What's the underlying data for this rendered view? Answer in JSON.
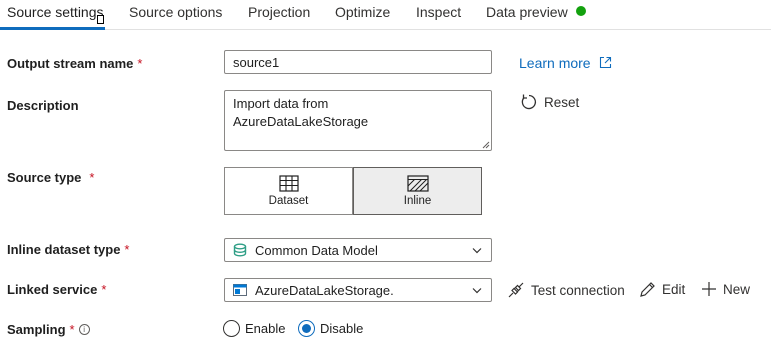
{
  "tabs": [
    {
      "label": "Source settings",
      "active": true
    },
    {
      "label": "Source options"
    },
    {
      "label": "Projection"
    },
    {
      "label": "Optimize"
    },
    {
      "label": "Inspect"
    },
    {
      "label": "Data preview",
      "status": "green-dot"
    }
  ],
  "form": {
    "output_stream_name": {
      "label": "Output stream name",
      "required_mark": "*",
      "value": "source1"
    },
    "description": {
      "label": "Description",
      "value": "Import data from\nAzureDataLakeStorage"
    },
    "source_type": {
      "label": "Source type",
      "required_mark": "*",
      "options": [
        {
          "label": "Dataset",
          "icon": "table-icon",
          "selected": false
        },
        {
          "label": "Inline",
          "icon": "inline-hatched-icon",
          "selected": true
        }
      ]
    },
    "inline_dataset_type": {
      "label": "Inline dataset type",
      "required_mark": "*",
      "value": "Common Data Model",
      "icon": "cdm-icon"
    },
    "linked_service": {
      "label": "Linked service",
      "required_mark": "*",
      "value": "AzureDataLakeStorage.",
      "icon": "storage-icon"
    },
    "sampling": {
      "label": "Sampling",
      "required_mark": "*",
      "info_icon": "i",
      "options": [
        {
          "label": "Enable",
          "selected": false
        },
        {
          "label": "Disable",
          "selected": true
        }
      ]
    }
  },
  "actions": {
    "learn_more": "Learn more",
    "reset": "Reset",
    "test_connection": "Test connection",
    "edit": "Edit",
    "new": "New"
  },
  "colors": {
    "accent": "#0f6cbd",
    "required": "#c50f1f",
    "status_green": "#13a10e"
  }
}
